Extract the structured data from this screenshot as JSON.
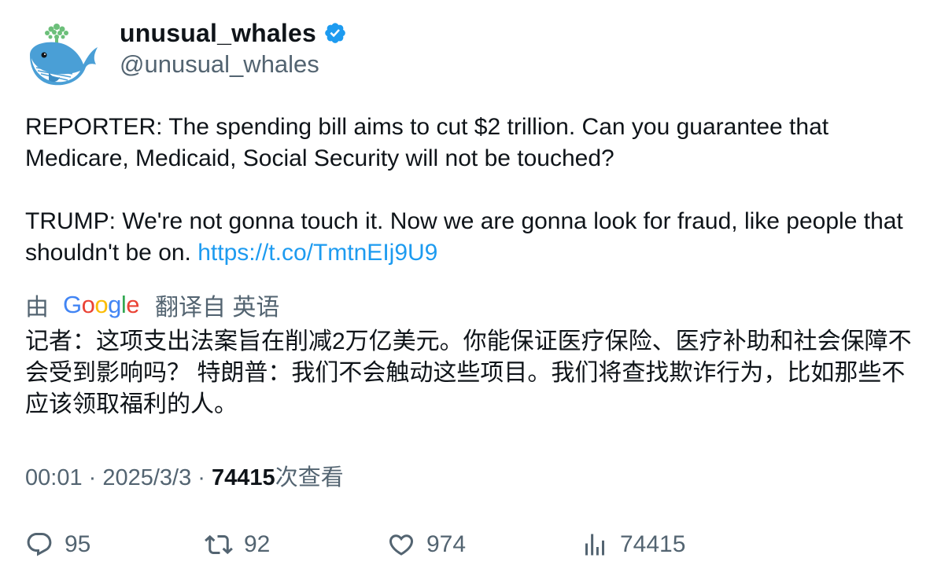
{
  "user": {
    "display_name": "unusual_whales",
    "handle": "@unusual_whales"
  },
  "tweet": {
    "text_part1": "REPORTER: The spending bill aims to cut $2 trillion. Can you guarantee that Medicare, Medicaid, Social Security will not be touched?\n\nTRUMP: We're not gonna touch it. Now we are gonna look for fraud, like people that shouldn't be on. ",
    "link": "https://t.co/TmtnEIj9U9"
  },
  "translation": {
    "by_label": "由",
    "provider": "Google",
    "translated_from": "翻译自 英语",
    "text": "记者：这项支出法案旨在削减2万亿美元。你能保证医疗保险、医疗补助和社会保障不会受到影响吗？ 特朗普：我们不会触动这些项目。我们将查找欺诈行为，比如那些不应该领取福利的人。"
  },
  "meta": {
    "time": "00:01",
    "separator": " · ",
    "date": "2025/3/3",
    "views_count": "74415",
    "views_label": "次查看"
  },
  "actions": {
    "replies": "95",
    "retweets": "92",
    "likes": "974",
    "views": "74415"
  },
  "colors": {
    "link": "#1d9bf0",
    "secondary_text": "#536471",
    "primary_text": "#0f1419"
  }
}
